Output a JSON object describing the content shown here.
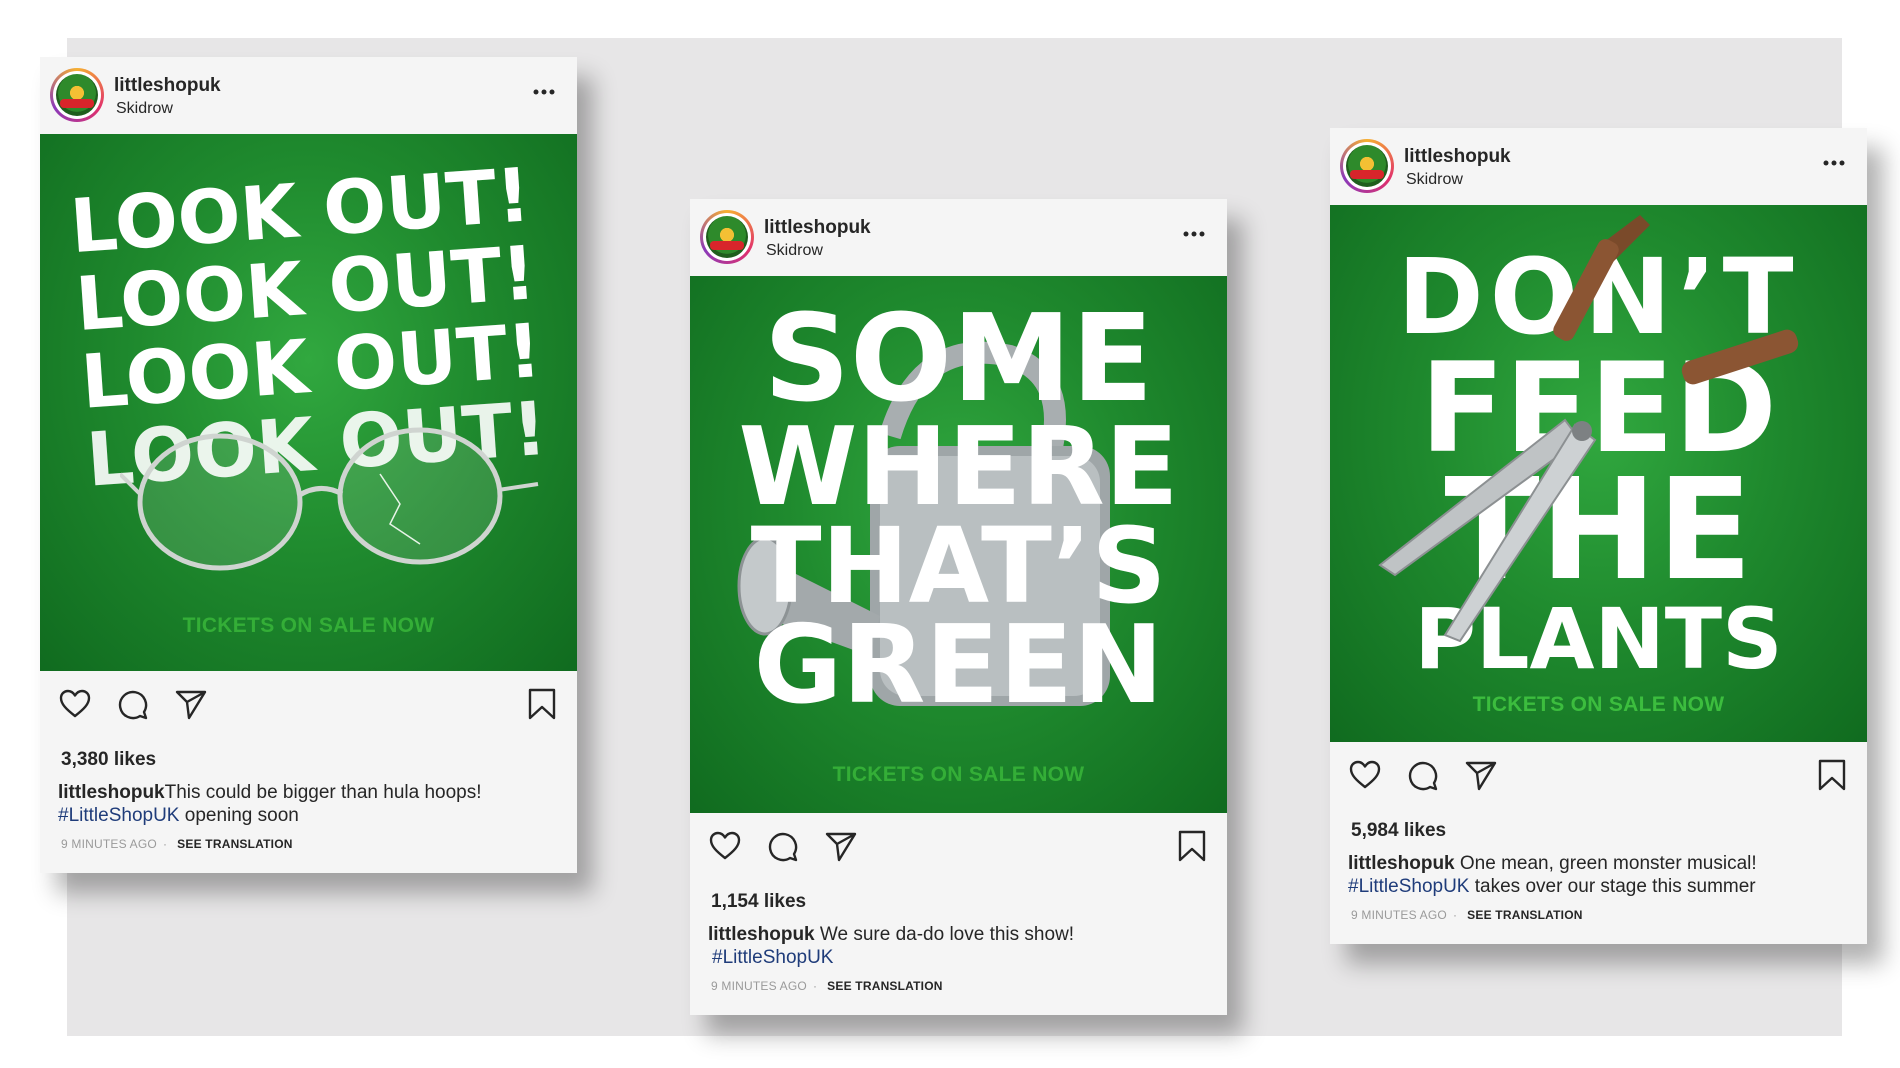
{
  "posts": [
    {
      "username": "littleshopuk",
      "location": "Skidrow",
      "headline": [
        "LOOK OUT!",
        "LOOK OUT!",
        "LOOK OUT!",
        "LOOK OUT!"
      ],
      "image_object": "round-glasses",
      "tickets": "TICKETS ON SALE NOW",
      "likes": "3,380 likes",
      "caption_user": "littleshopuk",
      "caption_text": "This could be bigger than hula hoops!",
      "hashtag": "#LittleShopUK",
      "caption_after": " opening soon",
      "time": "9 MINUTES AGO",
      "translation": "SEE TRANSLATION"
    },
    {
      "username": "littleshopuk",
      "location": "Skidrow",
      "headline": [
        "SOME",
        "WHERE",
        "THAT’S",
        "GREEN"
      ],
      "image_object": "watering-can",
      "tickets": "TICKETS ON SALE NOW",
      "likes": "1,154 likes",
      "caption_user": "littleshopuk",
      "caption_text": " We sure da-do love this show!",
      "hashtag": "#LittleShopUK",
      "caption_after": "",
      "time": "9 MINUTES AGO",
      "translation": "SEE TRANSLATION"
    },
    {
      "username": "littleshopuk",
      "location": "Skidrow",
      "headline": [
        "DON’T",
        "FEED",
        "THE",
        "PLANTS"
      ],
      "image_object": "hedge-shears",
      "tickets": "TICKETS ON SALE NOW",
      "likes": "5,984 likes",
      "caption_user": "littleshopuk",
      "caption_text": " One mean, green monster musical!",
      "hashtag": "#LittleShopUK",
      "caption_after": " takes over our stage this summer",
      "time": "9 MINUTES AGO",
      "translation": "SEE TRANSLATION"
    }
  ],
  "icons": {
    "avatar": "little-shop-logo",
    "more": "more-options-icon",
    "like": "heart-icon",
    "comment": "comment-icon",
    "share": "paper-plane-icon",
    "save": "bookmark-icon"
  },
  "colors": {
    "backdrop": "#e7e6e7",
    "card": "#f5f5f5",
    "poster_green": "#1f8a2e",
    "tickets_green": "#3cbd3e",
    "hashtag": "#1f3c7a"
  }
}
